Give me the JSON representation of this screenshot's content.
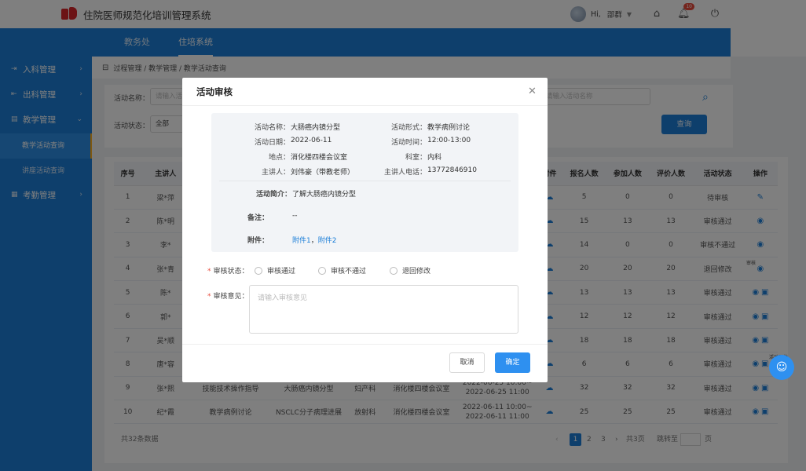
{
  "app": {
    "title": "住院医师规范化培训管理系统"
  },
  "user": {
    "greeting": "Hi,",
    "name": "邵群"
  },
  "notifications": {
    "count": "10"
  },
  "nav": {
    "tabs": [
      {
        "label": "教务处"
      },
      {
        "label": "住培系统"
      }
    ]
  },
  "sidebar": {
    "items": [
      {
        "label": "入科管理"
      },
      {
        "label": "出科管理"
      },
      {
        "label": "教学管理"
      },
      {
        "label": "考勤管理"
      }
    ],
    "subitems": [
      {
        "label": "教学活动查询"
      },
      {
        "label": "讲座活动查询"
      }
    ]
  },
  "breadcrumb": "过程管理 / 教学管理 / 教学活动查询",
  "filters": {
    "name_label": "活动名称：",
    "name_placeholder": "请输入活动名称",
    "right_placeholder": "请输入活动名称",
    "status_label": "活动状态：",
    "status_value": "全部",
    "query_button": "查询"
  },
  "table": {
    "columns": [
      "序号",
      "主讲人",
      "",
      "",
      "",
      "",
      "",
      "",
      "附件",
      "报名人数",
      "参加人数",
      "评价人数",
      "活动状态",
      "操作"
    ],
    "rows": [
      {
        "no": "1",
        "speaker": "梁*萍",
        "form": "",
        "topic": "",
        "dept": "",
        "place": "",
        "time": "",
        "signup": "5",
        "attend": "0",
        "eval": "0",
        "status": "待审核"
      },
      {
        "no": "2",
        "speaker": "陈*明",
        "form": "",
        "topic": "",
        "dept": "",
        "place": "",
        "time": "",
        "signup": "15",
        "attend": "13",
        "eval": "13",
        "status": "审核通过"
      },
      {
        "no": "3",
        "speaker": "李*",
        "form": "",
        "topic": "",
        "dept": "",
        "place": "",
        "time": "",
        "signup": "14",
        "attend": "0",
        "eval": "0",
        "status": "审核不通过"
      },
      {
        "no": "4",
        "speaker": "张*青",
        "form": "",
        "topic": "",
        "dept": "",
        "place": "",
        "time": "",
        "signup": "20",
        "attend": "20",
        "eval": "20",
        "status": "退回修改"
      },
      {
        "no": "5",
        "speaker": "陈*",
        "form": "",
        "topic": "",
        "dept": "",
        "place": "",
        "time": "",
        "signup": "13",
        "attend": "13",
        "eval": "13",
        "status": "审核通过"
      },
      {
        "no": "6",
        "speaker": "郭*",
        "form": "",
        "topic": "",
        "dept": "",
        "place": "",
        "time": "",
        "signup": "12",
        "attend": "12",
        "eval": "12",
        "status": "审核通过"
      },
      {
        "no": "7",
        "speaker": "吴*顺",
        "form": "",
        "topic": "",
        "dept": "",
        "place": "",
        "time": "",
        "signup": "18",
        "attend": "18",
        "eval": "18",
        "status": "审核通过"
      },
      {
        "no": "8",
        "speaker": "唐*容",
        "form": "",
        "topic": "",
        "dept": "",
        "place": "",
        "time": "",
        "signup": "6",
        "attend": "6",
        "eval": "6",
        "status": "审核通过"
      },
      {
        "no": "9",
        "speaker": "张*熙",
        "form": "技能技术操作指导",
        "topic": "大肠癌内镜分型",
        "dept": "妇产科",
        "place": "消化楼四楼会议室",
        "time": "2022-06-25 10:00~\n2022-06-25 11:00",
        "signup": "32",
        "attend": "32",
        "eval": "32",
        "status": "审核通过"
      },
      {
        "no": "10",
        "speaker": "纪*霞",
        "form": "教学病例讨论",
        "topic": "NSCLC分子病理进展",
        "dept": "放射科",
        "place": "消化楼四楼会议室",
        "time": "2022-06-11 10:00~\n2022-06-11 11:00",
        "signup": "25",
        "attend": "25",
        "eval": "25",
        "status": "审核通过"
      }
    ],
    "tips": {
      "review": "审核",
      "photo": "活动图片"
    }
  },
  "pager": {
    "total": "共32条数据",
    "pages": [
      "1",
      "2",
      "3"
    ],
    "total_pages": "共3页",
    "goto_label": "跳转至",
    "page_suffix": "页"
  },
  "modal": {
    "title": "活动审核",
    "info": {
      "name_label": "活动名称：",
      "name": "大肠癌内镜分型",
      "form_label": "活动形式：",
      "form": "教学病例讨论",
      "date_label": "活动日期：",
      "date": "2022-06-11",
      "time_label": "活动时间：",
      "time": "12:00-13:00",
      "place_label": "地点：",
      "place": "消化楼四楼会议室",
      "dept_label": "科室：",
      "dept": "内科",
      "speaker_label": "主讲人：",
      "speaker": "刘伟豪（带教老师）",
      "phone_label": "主讲人电话：",
      "phone": "13772846910",
      "intro_label": "活动简介：",
      "intro": "了解大肠癌内镜分型",
      "remark_label": "备注：",
      "remark": "--",
      "attach_label": "附件：",
      "attach1": "附件1",
      "attach_sep": "，",
      "attach2": "附件2"
    },
    "status_label": "审核状态：",
    "options": [
      "审核通过",
      "审核不通过",
      "退回修改"
    ],
    "opinion_label": "审核意见：",
    "opinion_placeholder": "请输入审核意见",
    "cancel": "取消",
    "ok": "确定"
  }
}
